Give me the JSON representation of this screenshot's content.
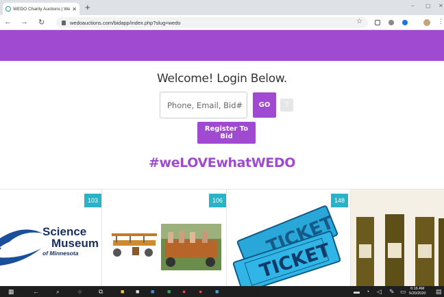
{
  "browser": {
    "tab_title": "WEDO Charity Auctions | Well...",
    "url": "wedoauctions.com/bidapp/index.php?slug=wedo"
  },
  "login": {
    "welcome": "Welcome! Login Below.",
    "input_placeholder": "Phone, Email, Bid#",
    "go_label": "GO",
    "help_label": "?",
    "register_label": "Register To Bid"
  },
  "hashtag": "#weLOVEwhatWEDO",
  "items": [
    {
      "lot": "103",
      "image": "Science Museum of Minnesota logo",
      "logo_text": [
        "Science",
        "Museum",
        "of Minnesota"
      ]
    },
    {
      "lot": "106",
      "image": "Pedal pub bike photos"
    },
    {
      "lot": "148",
      "image": "Blue tickets",
      "ticket_text": "TICKET"
    },
    {
      "lot": "",
      "image": "Wine bottles"
    }
  ],
  "taskbar": {
    "time": "6:16 AM",
    "date": "5/20/2020"
  },
  "colors": {
    "brand_purple": "#a04ad1",
    "badge_teal": "#2ab3c6"
  }
}
